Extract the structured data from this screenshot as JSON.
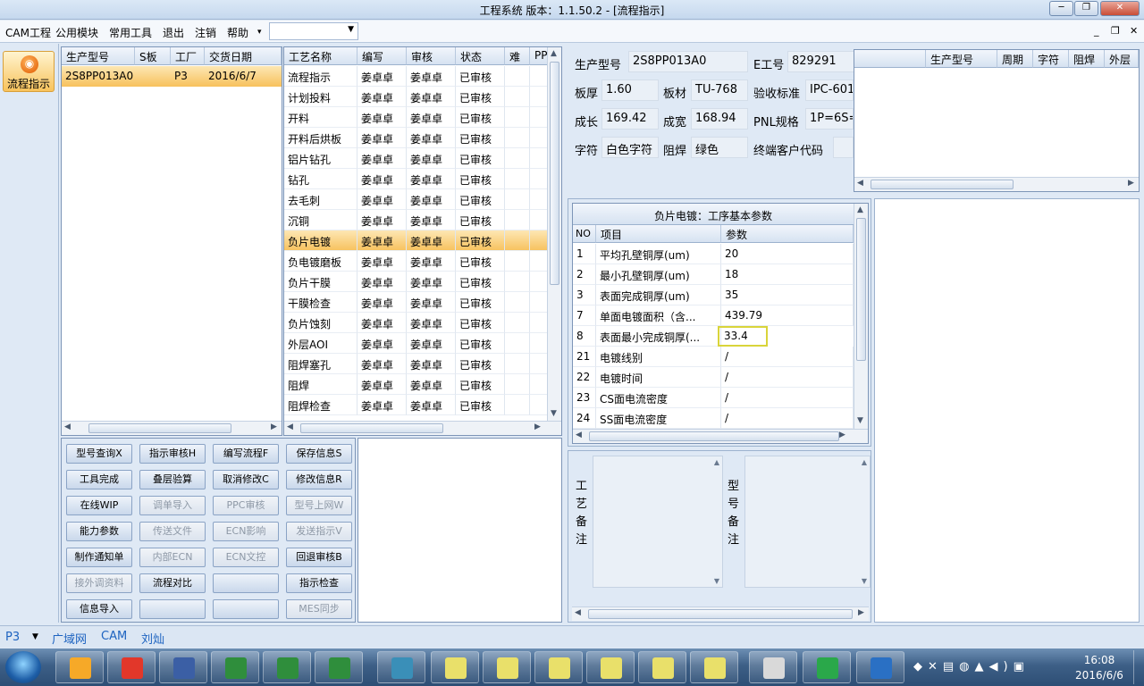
{
  "window": {
    "title": "工程系统  版本：1.1.50.2 - [流程指示]"
  },
  "menu": {
    "items": [
      "CAM工程",
      "公用模块",
      "常用工具",
      "退出",
      "注销",
      "帮助"
    ],
    "help_arrow": "▾",
    "combo_value": ""
  },
  "rail": {
    "flow_label": "流程指示"
  },
  "model_grid": {
    "headers": [
      "生产型号",
      "S板",
      "工厂",
      "交货日期"
    ],
    "rows": [
      [
        "2S8PP013A0",
        "",
        "P3",
        "2016/6/7"
      ]
    ]
  },
  "process_grid": {
    "headers": [
      "工艺名称",
      "编写",
      "审核",
      "状态",
      "难",
      "PP"
    ],
    "rows": [
      [
        "流程指示",
        "姜卓卓",
        "姜卓卓",
        "已审核"
      ],
      [
        "计划投料",
        "姜卓卓",
        "姜卓卓",
        "已审核"
      ],
      [
        "开料",
        "姜卓卓",
        "姜卓卓",
        "已审核"
      ],
      [
        "开料后烘板",
        "姜卓卓",
        "姜卓卓",
        "已审核"
      ],
      [
        "铝片钻孔",
        "姜卓卓",
        "姜卓卓",
        "已审核"
      ],
      [
        "钻孔",
        "姜卓卓",
        "姜卓卓",
        "已审核"
      ],
      [
        "去毛刺",
        "姜卓卓",
        "姜卓卓",
        "已审核"
      ],
      [
        "沉铜",
        "姜卓卓",
        "姜卓卓",
        "已审核"
      ],
      [
        "负片电镀",
        "姜卓卓",
        "姜卓卓",
        "已审核"
      ],
      [
        "负电镀磨板",
        "姜卓卓",
        "姜卓卓",
        "已审核"
      ],
      [
        "负片干膜",
        "姜卓卓",
        "姜卓卓",
        "已审核"
      ],
      [
        "干膜检查",
        "姜卓卓",
        "姜卓卓",
        "已审核"
      ],
      [
        "负片蚀刻",
        "姜卓卓",
        "姜卓卓",
        "已审核"
      ],
      [
        "外层AOI",
        "姜卓卓",
        "姜卓卓",
        "已审核"
      ],
      [
        "阻焊塞孔",
        "姜卓卓",
        "姜卓卓",
        "已审核"
      ],
      [
        "阻焊",
        "姜卓卓",
        "姜卓卓",
        "已审核"
      ],
      [
        "阻焊检查",
        "姜卓卓",
        "姜卓卓",
        "已审核"
      ]
    ],
    "selected_index": 8
  },
  "buttons": [
    {
      "label": "型号查询X",
      "enabled": true
    },
    {
      "label": "指示审核H",
      "enabled": true
    },
    {
      "label": "编写流程F",
      "enabled": true
    },
    {
      "label": "保存信息S",
      "enabled": true
    },
    {
      "label": "工具完成",
      "enabled": true
    },
    {
      "label": "叠层验算",
      "enabled": true
    },
    {
      "label": "取消修改C",
      "enabled": true
    },
    {
      "label": "修改信息R",
      "enabled": true
    },
    {
      "label": "在线WIP",
      "enabled": true
    },
    {
      "label": "调单导入",
      "enabled": false
    },
    {
      "label": "PPC审核",
      "enabled": false
    },
    {
      "label": "型号上网W",
      "enabled": false
    },
    {
      "label": "能力参数",
      "enabled": true
    },
    {
      "label": "传送文件",
      "enabled": false
    },
    {
      "label": "ECN影响",
      "enabled": false
    },
    {
      "label": "发送指示V",
      "enabled": false
    },
    {
      "label": "制作通知单",
      "enabled": true
    },
    {
      "label": "内部ECN",
      "enabled": false
    },
    {
      "label": "ECN文控",
      "enabled": false
    },
    {
      "label": "回退审核B",
      "enabled": true
    },
    {
      "label": "接外调资料",
      "enabled": false
    },
    {
      "label": "流程对比",
      "enabled": true
    },
    {
      "label": "",
      "enabled": true
    },
    {
      "label": "指示检查",
      "enabled": true
    },
    {
      "label": "信息导入",
      "enabled": true
    },
    {
      "label": "",
      "enabled": true
    },
    {
      "label": "",
      "enabled": true
    },
    {
      "label": "MES同步",
      "enabled": false
    }
  ],
  "info": {
    "model_label": "生产型号",
    "model_value": "2S8PP013A0",
    "e_label": "E工号",
    "e_value": "829291",
    "thick_label": "板厚",
    "thick_value": "1.60",
    "material_label": "板材",
    "material_value": "TU-768",
    "std_label": "验收标准",
    "std_value": "IPC-601",
    "len_label": "成长",
    "len_value": "169.42",
    "wid_label": "成宽",
    "wid_value": "168.94",
    "pnl_label": "PNL规格",
    "pnl_value": "1P=6S=",
    "char_label": "字符",
    "char_value": "白色字符",
    "mask_label": "阻焊",
    "mask_value": "绿色",
    "cust_label": "终端客户代码",
    "cust_value": ""
  },
  "right_grid": {
    "headers": [
      "生产型号",
      "周期",
      "字符",
      "阻焊",
      "外层"
    ]
  },
  "params": {
    "title": "负片电镀：工序基本参数",
    "headers": [
      "NO",
      "项目",
      "参数"
    ],
    "rows": [
      [
        "1",
        "平均孔壁铜厚(um)",
        "20"
      ],
      [
        "2",
        "最小孔壁铜厚(um)",
        "18"
      ],
      [
        "3",
        "表面完成铜厚(um)",
        "35"
      ],
      [
        "7",
        "单面电镀面积（含...",
        "439.79"
      ],
      [
        "8",
        "表面最小完成铜厚(...",
        "33.4"
      ],
      [
        "21",
        "电镀线别",
        "/"
      ],
      [
        "22",
        "电镀时间",
        "/"
      ],
      [
        "23",
        "CS面电流密度",
        "/"
      ],
      [
        "24",
        "SS面电流密度",
        "/"
      ]
    ],
    "highlighted_row": 4
  },
  "notes": {
    "process_label": "工艺备注",
    "model_label": "型号备注"
  },
  "status": {
    "factory": "P3",
    "items": [
      "广域网",
      "CAM",
      "刘灿"
    ]
  },
  "taskbar": {
    "time": "16:08",
    "date": "2016/6/6"
  },
  "colors": {
    "selection": "#f7c15c",
    "highlight_border": "#d9d43a",
    "accent": "#1d63c0"
  }
}
